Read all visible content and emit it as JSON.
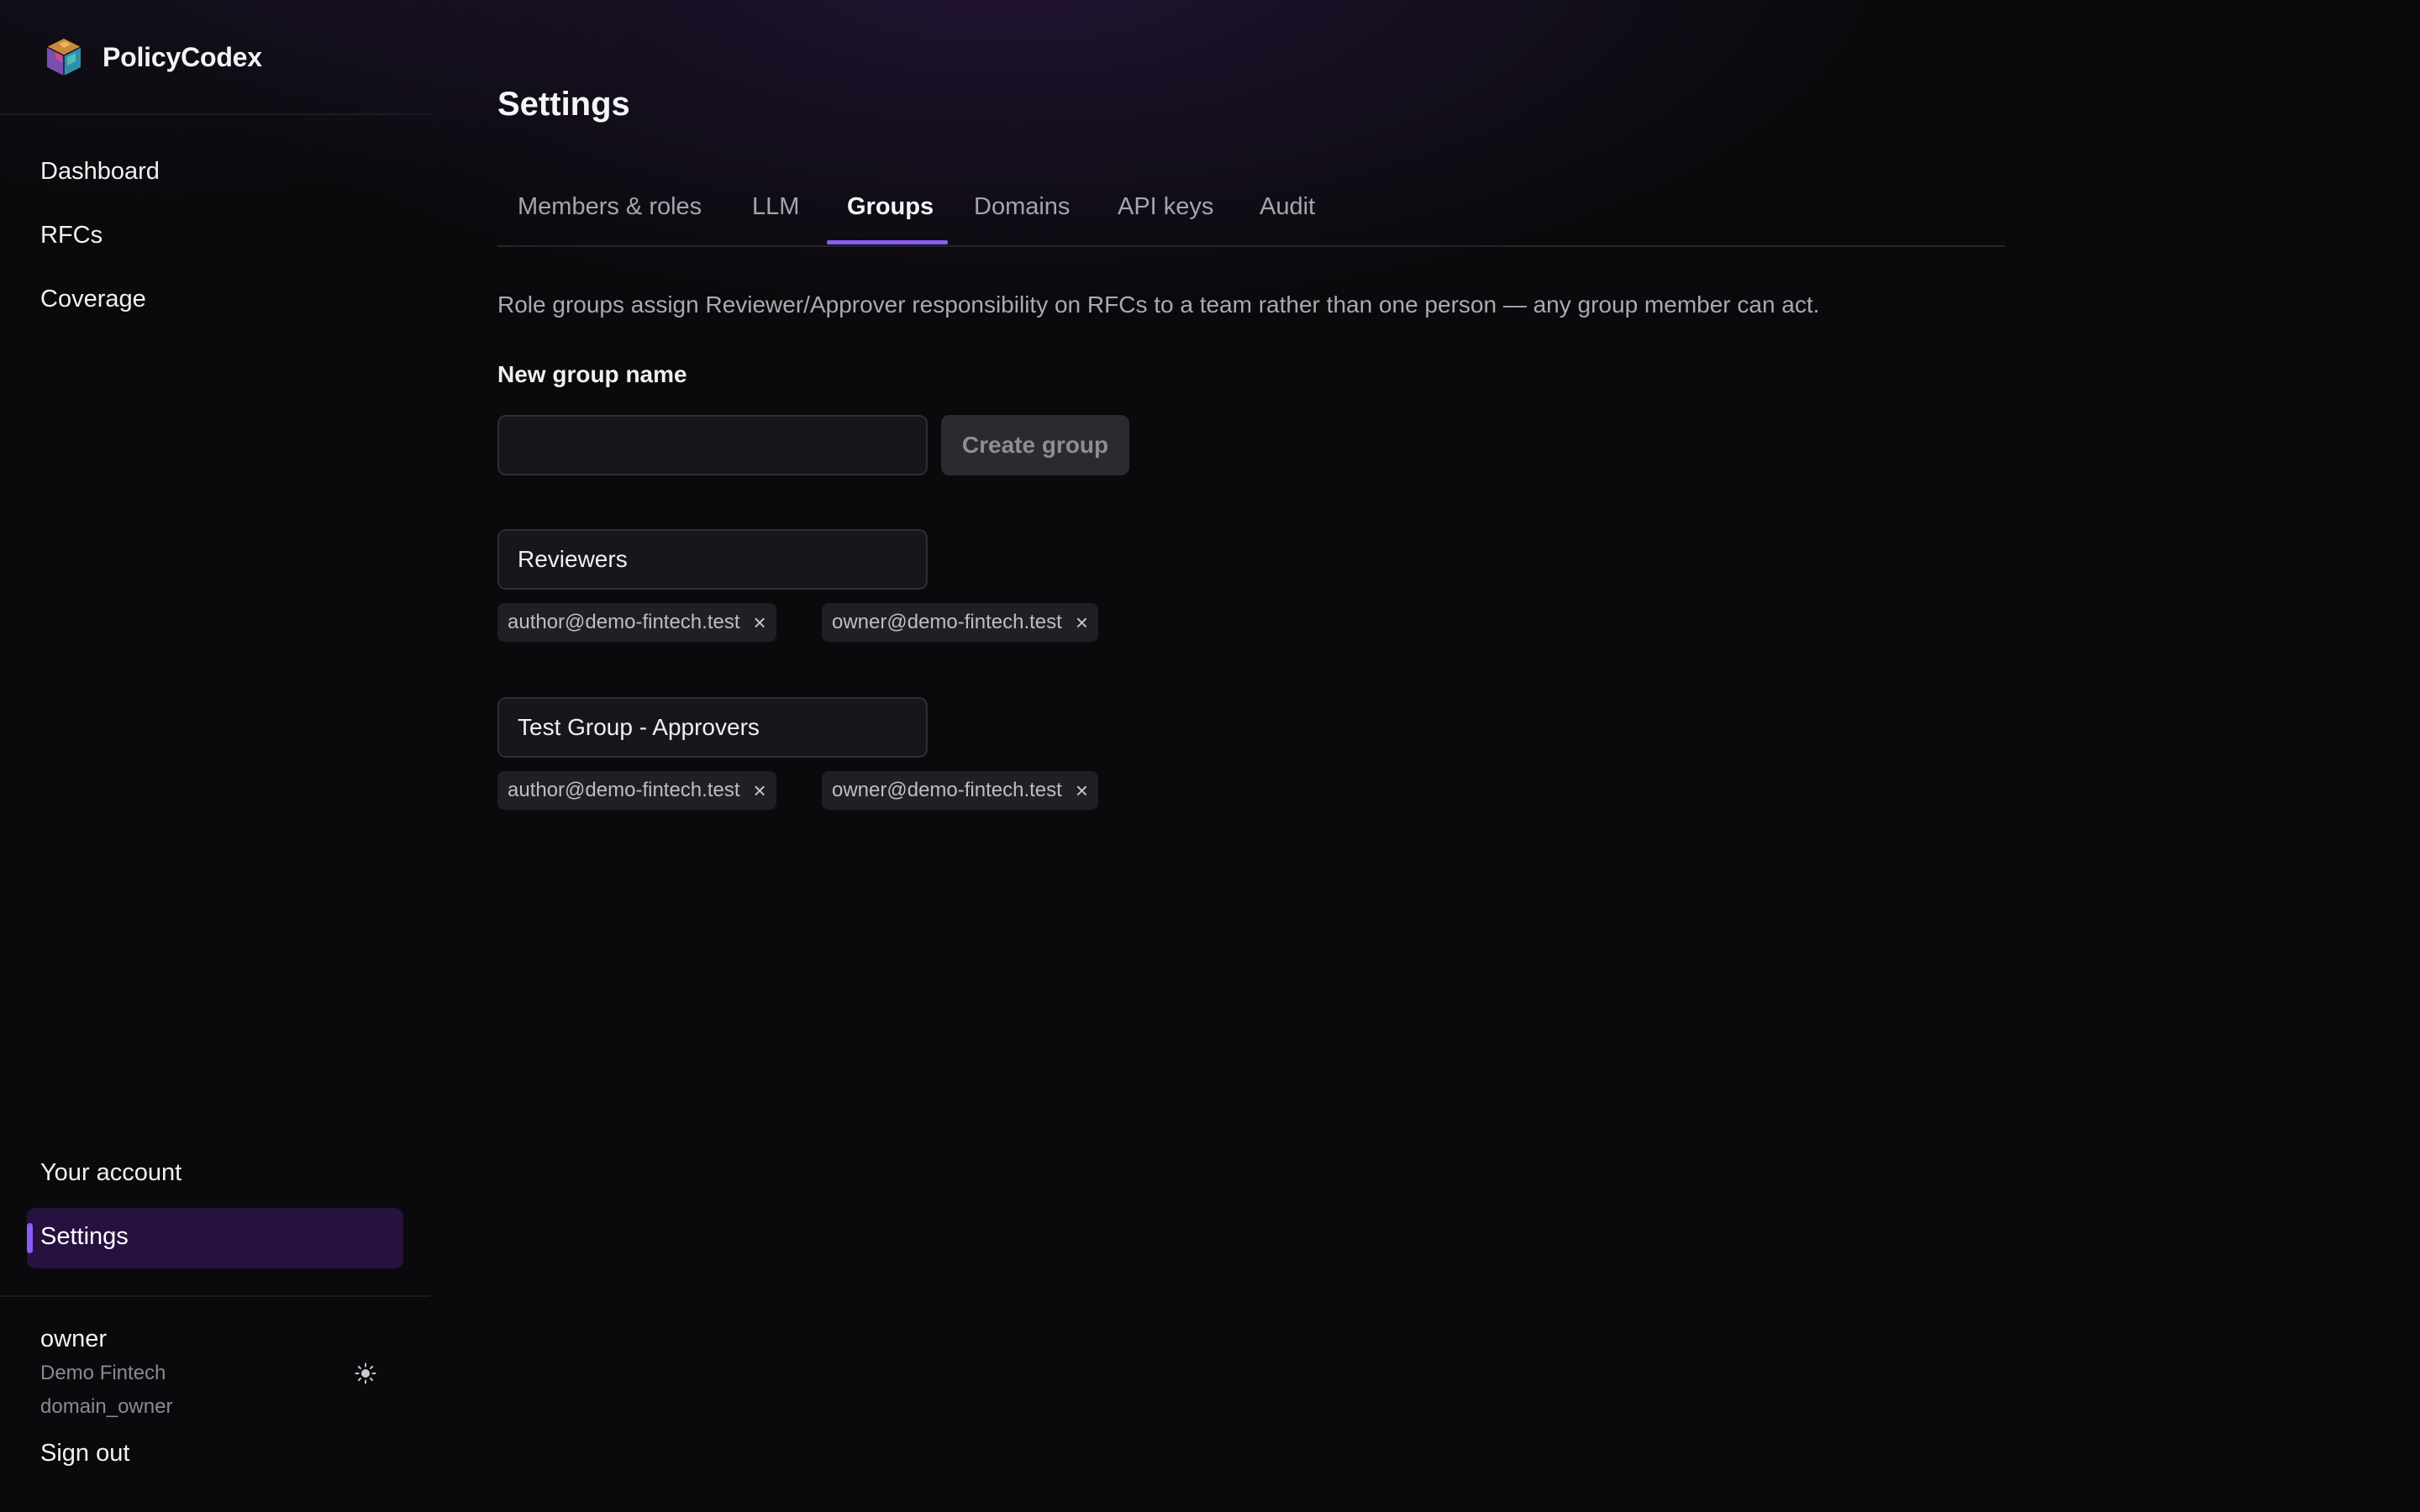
{
  "app": {
    "name": "PolicyCodex",
    "logo_icon": "cube-logo-icon"
  },
  "sidebar": {
    "items": [
      {
        "label": "Dashboard"
      },
      {
        "label": "RFCs"
      },
      {
        "label": "Coverage"
      }
    ],
    "bottom_items": [
      {
        "label": "Your account"
      },
      {
        "label": "Settings",
        "active": true
      }
    ],
    "user": {
      "name": "owner",
      "org": "Demo Fintech",
      "role": "domain_owner"
    },
    "theme_toggle_icon": "sun-icon",
    "sign_out_label": "Sign out"
  },
  "page": {
    "title": "Settings",
    "tabs": [
      {
        "label": "Members & roles"
      },
      {
        "label": "LLM"
      },
      {
        "label": "Groups",
        "active": true
      },
      {
        "label": "Domains"
      },
      {
        "label": "API keys"
      },
      {
        "label": "Audit"
      }
    ],
    "description": "Role groups assign Reviewer/Approver responsibility on RFCs to a team rather than one person — any group member can act.",
    "new_group": {
      "label": "New group name",
      "value": "",
      "placeholder": "",
      "create_label": "Create group"
    },
    "groups": [
      {
        "name": "Reviewers",
        "members": [
          "author@demo-fintech.test",
          "owner@demo-fintech.test"
        ]
      },
      {
        "name": "Test Group - Approvers",
        "members": [
          "author@demo-fintech.test",
          "owner@demo-fintech.test"
        ]
      }
    ],
    "remove_glyph": "×"
  },
  "colors": {
    "accent": "#8b5cf6",
    "active_nav_bg": "#26113f",
    "background": "#0a0a0c"
  }
}
